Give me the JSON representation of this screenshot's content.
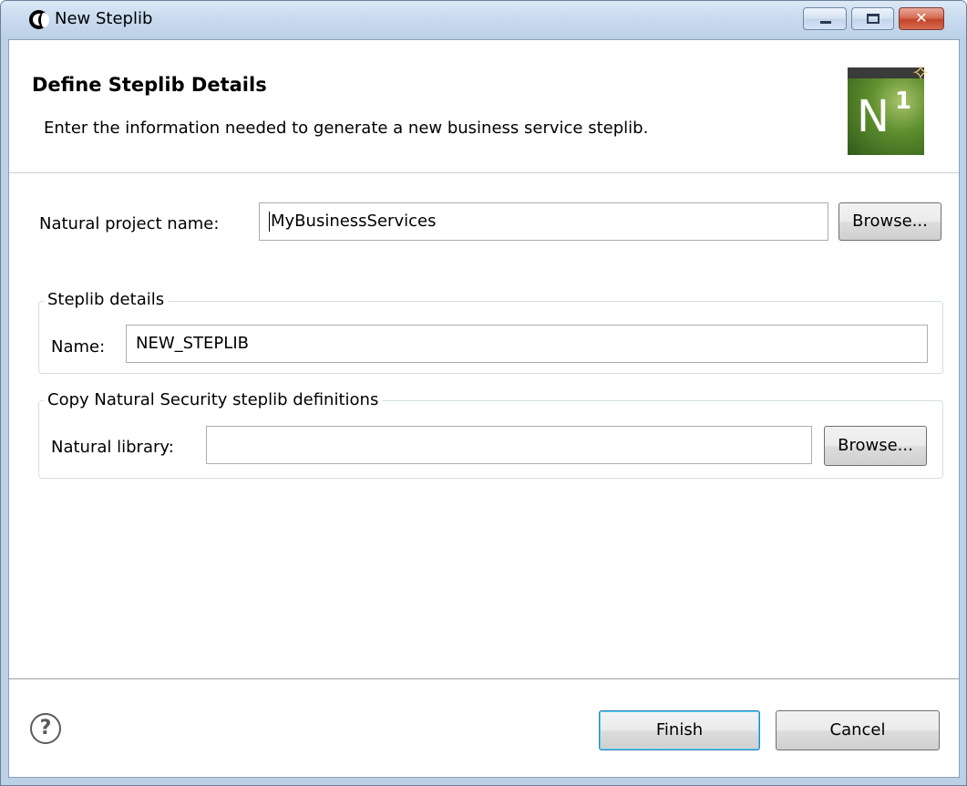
{
  "window": {
    "title": "New Steplib",
    "controls": {
      "minimize_icon": "minimize-icon",
      "maximize_icon": "maximize-icon",
      "close_icon": "close-icon",
      "close_glyph": "✕"
    }
  },
  "header": {
    "title": "Define Steplib Details",
    "description": "Enter the information needed to generate a new business service steplib.",
    "logo": {
      "letter": "N",
      "superscript": "1"
    }
  },
  "form": {
    "project_label": "Natural project name:",
    "project_value": "MyBusinessServices",
    "browse_label": "Browse...",
    "steplib_group": {
      "title": "Steplib details",
      "name_label": "Name:",
      "name_value": "NEW_STEPLIB"
    },
    "security_group": {
      "title": "Copy Natural Security steplib definitions",
      "library_label": "Natural library:",
      "library_value": "",
      "browse_label": "Browse..."
    }
  },
  "footer": {
    "help_glyph": "?",
    "finish_label": "Finish",
    "cancel_label": "Cancel"
  },
  "colors": {
    "titlebar": "#c9dbef",
    "close_button": "#c2452b",
    "default_button_border": "#3c7fb1",
    "logo_green": "#5f8f2e"
  }
}
